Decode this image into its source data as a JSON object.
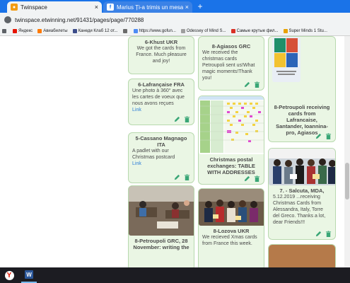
{
  "browser": {
    "tabs": [
      {
        "title": "Twinspace",
        "favicon": "twinspace-favicon"
      },
      {
        "title": "Marius Ți-a trimis un mesaj",
        "favicon": "facebook-favicon"
      }
    ],
    "new_tab_label": "+",
    "close_glyph": "×",
    "url": "twinspace.etwinning.net/91431/pages/page/770288",
    "bookmarks": [
      {
        "label": "",
        "icon": "apps-icon",
        "color": "#5f6368"
      },
      {
        "label": "Яндекс",
        "icon": "yandex-icon",
        "color": "#e61400"
      },
      {
        "label": "Авиабилеты",
        "icon": "plane-icon",
        "color": "#ff7a00"
      },
      {
        "label": "Канеди Клаб 12 от...",
        "icon": "club-icon",
        "color": "#3c4d8a"
      },
      {
        "label": "",
        "icon": "bookmark-icon",
        "color": "#6b6b6b"
      },
      {
        "label": "https://www.gofun...",
        "icon": "globe-icon",
        "color": "#4c8bf5"
      },
      {
        "label": "Odessey of Mind S...",
        "icon": "page-icon",
        "color": "#9e9e9e"
      },
      {
        "label": "Самые крутые фил...",
        "icon": "film-icon",
        "color": "#d93025"
      },
      {
        "label": "Super Minds 1 Stu...",
        "icon": "book-icon",
        "color": "#e8a200"
      }
    ]
  },
  "cards": {
    "khust": {
      "title": "6-Khust UKR",
      "text": "We got the cards from France. Much pleasure and joy!"
    },
    "lafrancaise": {
      "title": "6-Lafrançaise FRA",
      "text": "Une photo à 360° avec les cartes de voeux que nous avons reçues",
      "link": "Link"
    },
    "cassano": {
      "title": "5-Cassano Magnago ITA",
      "text": "A padlet with our Christmas postcard",
      "link": "Link"
    },
    "petroupoli_grc": {
      "title": "8-Petroupoli GRC, 28 November: writing the"
    },
    "agiasos": {
      "title": "8-Agiasos GRC",
      "text": "We received the christmas cards Petroupoli sent us!What magic moments!Thank you!"
    },
    "exchanges": {
      "title": "Christmas postal exchanges: TABLE WITH ADDRESSES"
    },
    "lozova": {
      "title": "8-Lozova UKR",
      "text": "We recieved Xmas cards from France this week."
    },
    "petroupoli_receiving": {
      "title": "8-Petroupoli receiving cards from Lafrancaise, Santander, Ioannina-pro, Agiasos"
    },
    "salcuta": {
      "title": "7. - Salcuta, MDA,",
      "text": "5.12.2019 ...receiving Christmas Cards from Alessandra, Italy, Torre del Greco. Thanks a lot, dear Friends!!!"
    }
  },
  "taskbar": {
    "yandex_letter": "Y",
    "word_letter": "W"
  },
  "colors": {
    "card_bg": "#eaf6e4",
    "card_border": "#b8d9ae",
    "tool_green": "#3aa676",
    "link_blue": "#2a7bd8",
    "tab_blue": "#1a73e8"
  }
}
